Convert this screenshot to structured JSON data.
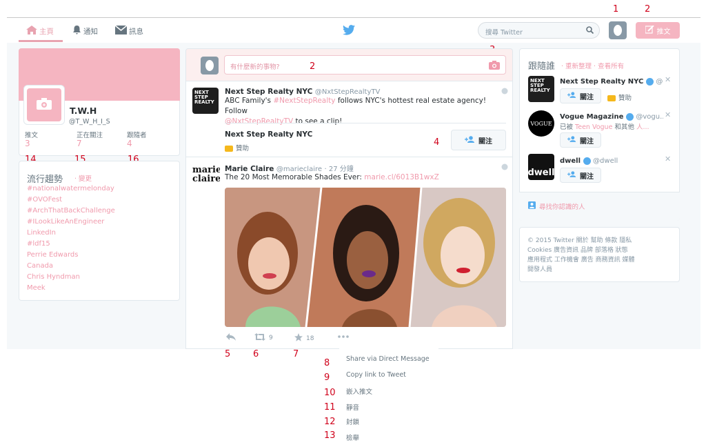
{
  "nav": {
    "home": "主頁",
    "notifications": "通知",
    "messages": "訊息",
    "search_placeholder": "搜尋 Twitter",
    "tweet_button": "推文"
  },
  "annotations": {
    "a1": "1",
    "a2": "2",
    "a3": "3",
    "a2b": "2",
    "a4": "4",
    "a5": "5",
    "a6": "6",
    "a7": "7",
    "a8": "8",
    "a9": "9",
    "a10": "10",
    "a11": "11",
    "a12": "12",
    "a13": "13",
    "a14": "14",
    "a15": "15",
    "a16": "16"
  },
  "profile": {
    "name": "T.W.H",
    "handle": "@T_W_H_I_S",
    "stats": [
      {
        "label": "推文",
        "value": "3"
      },
      {
        "label": "正在關注",
        "value": "7"
      },
      {
        "label": "跟隨者",
        "value": "4"
      }
    ]
  },
  "trends": {
    "title": "流行趨勢",
    "change": "· 變更",
    "items": [
      "#nationalwatermelonday",
      "#OVOFest",
      "#ArchThatBackChallenge",
      "#ILookLikeAnEngineer",
      "LinkedIn",
      "#ldf15",
      "Perrie Edwards",
      "Canada",
      "Chris Hyndman",
      "Meek"
    ]
  },
  "compose": {
    "placeholder": "有什麼新的事物?"
  },
  "tweet1": {
    "name": "Next Step Realty NYC",
    "handle": "@NxtStepRealtyTV",
    "text_a": "ABC Family's ",
    "text_link1": "#NextStepRealty",
    "text_b": " follows NYC's hottest real estate agency! Follow",
    "text_link2": "@NxtStepRealtyTV",
    "text_c": " to see a clip!",
    "promo_name": "Next Step Realty NYC",
    "promo_label": "贊助",
    "follow": "關注",
    "avatar_text": "NEXT STEP REALTY"
  },
  "tweet2": {
    "name": "Marie Claire",
    "handle": "@marieclaire",
    "time": "· 27 分鐘",
    "text": "The 20 Most Memorable Shades Ever: ",
    "link": "marie.cl/6013B1wxZ",
    "avatar_text": "marie claire",
    "retweets": "9",
    "likes": "18"
  },
  "menu": [
    "Share via Direct Message",
    "Copy link to Tweet",
    "嵌入推文",
    "靜音",
    "封鎖",
    "檢舉"
  ],
  "wtf": {
    "title": "跟隨誰",
    "links": "· 重新整理 · 查看所有",
    "items": [
      {
        "name": "Next Step Realty NYC",
        "handle": "@...",
        "follow": "關注",
        "meta": "贊助"
      },
      {
        "name": "Vogue Magazine",
        "handle": "@vogu...",
        "meta_a": "已被 ",
        "meta_link": "Teen Vogue",
        "meta_b": " 和其他 ",
        "meta_c": "人...",
        "follow": "關注",
        "avatar_text": "VOGUE"
      },
      {
        "name": "dwell",
        "handle": "@dwell",
        "follow": "關注",
        "avatar_text": "dwell"
      }
    ],
    "find_friends": "尋找你認識的人"
  },
  "footer": {
    "line1": "© 2015 Twitter  關於  幫助  條款  隱私",
    "line2": "Cookies  廣告資訊  品牌  部落格  狀態",
    "line3": "應用程式  工作機會  廣告  商務資訊  媒體",
    "line4": "開發人員"
  }
}
